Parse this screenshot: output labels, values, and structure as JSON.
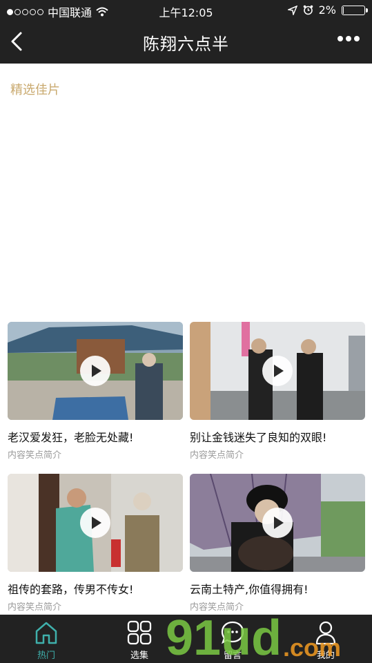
{
  "status_bar": {
    "carrier": "中国联通",
    "time": "上午12:05",
    "battery": "2%",
    "battery_level": 0.02,
    "signal_bars": 1
  },
  "nav": {
    "title": "陈翔六点半",
    "back_icon": "chevron-left-icon",
    "more_icon": "more-dots-icon"
  },
  "section": {
    "title": "精选佳片"
  },
  "videos": [
    {
      "title": "老汉爱发狂，老脸无处藏!",
      "subtitle": "内容笑点简介"
    },
    {
      "title": "别让金钱迷失了良知的双眼!",
      "subtitle": "内容笑点简介"
    },
    {
      "title": "祖传的套路，传男不传女!",
      "subtitle": "内容笑点简介"
    },
    {
      "title": "云南土特产,你值得拥有!",
      "subtitle": "内容笑点简介"
    }
  ],
  "tabbar": {
    "items": [
      {
        "label": "热门",
        "icon": "home-icon",
        "active": true
      },
      {
        "label": "选集",
        "icon": "grid-icon",
        "active": false
      },
      {
        "label": "留言",
        "icon": "message-icon",
        "active": false
      },
      {
        "label": "我的",
        "icon": "user-icon",
        "active": false
      }
    ]
  },
  "colors": {
    "accent": "#3fb0ac",
    "section_title": "#c9a96e",
    "bar_bg": "#222222"
  },
  "watermark": {
    "text": "91ud.com"
  }
}
